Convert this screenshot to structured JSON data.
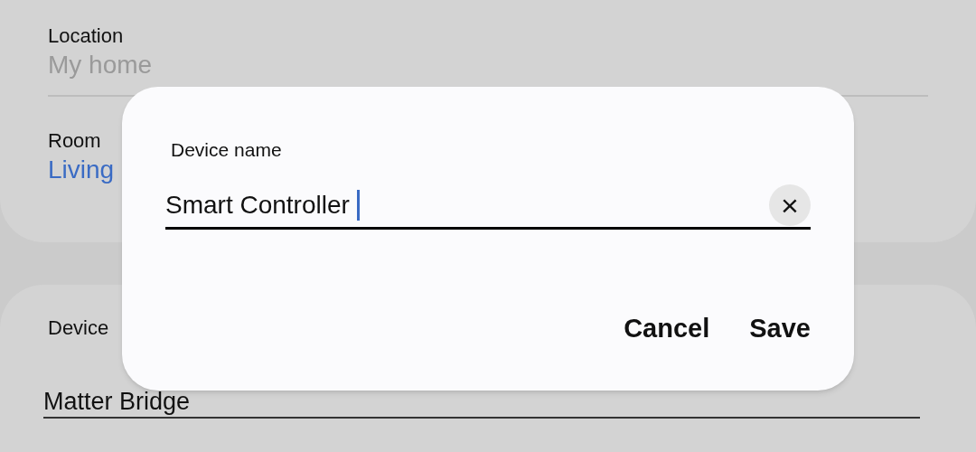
{
  "settings": {
    "location": {
      "label": "Location",
      "value": "My home"
    },
    "room": {
      "label": "Room",
      "value": "Living"
    },
    "device": {
      "label": "Device",
      "value": "Matter Bridge"
    }
  },
  "dialog": {
    "label": "Device name",
    "value": "Smart Controller",
    "clear": "×",
    "buttons": [
      "Cancel",
      "Save"
    ]
  }
}
